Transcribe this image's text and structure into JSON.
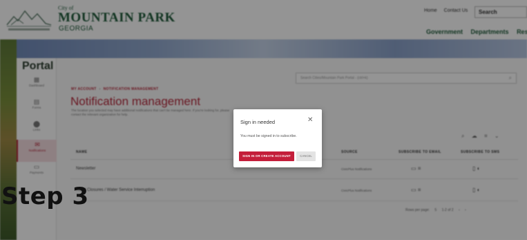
{
  "header": {
    "city_of": "City of",
    "city_name": "MOUNTAIN PARK",
    "state": "GEORGIA",
    "top_links": [
      "Home",
      "Contact Us"
    ],
    "search_placeholder": "Search",
    "nav": [
      "Government",
      "Departments",
      "Reso"
    ]
  },
  "sidebar": {
    "title": "Portal",
    "items": [
      {
        "label": "Dashboard",
        "icon": "dashboard-icon",
        "glyph": "▦"
      },
      {
        "label": "Forms",
        "icon": "forms-icon",
        "glyph": "▤"
      },
      {
        "label": "Links",
        "icon": "links-icon",
        "glyph": "⬤"
      },
      {
        "label": "Notifications",
        "icon": "notifications-icon",
        "glyph": "✉"
      },
      {
        "label": "Payments",
        "icon": "payments-icon",
        "glyph": "▭"
      }
    ]
  },
  "main": {
    "search_placeholder": "Search Cities/Mountain Park Portal - (ctrl+k)",
    "breadcrumb": [
      "MY ACCOUNT",
      "NOTIFICATION MANAGEMENT"
    ],
    "title": "Notification management",
    "description": "The location you selected may have additional notifications that can't be managed here. If you're looking for, please contact the relevant organization for help.",
    "table": {
      "headers": [
        "NAME",
        "SOURCE",
        "SUBSCRIBE TO EMAIL",
        "SUBSCRIBE TO SMS"
      ],
      "rows": [
        {
          "name": "Newsletter",
          "source": "CivicPlus Notifications"
        },
        {
          "name": "Road Closures / Water Service Interruption",
          "source": "CivicPlus Notifications"
        }
      ]
    },
    "pager": {
      "rows_per_page": "Rows per page:",
      "rows_value": "5",
      "range": "1-2 of 2"
    }
  },
  "modal": {
    "title": "Sign in needed",
    "close_glyph": "✕",
    "body": "You must be signed in to subscribe.",
    "primary": "SIGN IN OR CREATE ACCOUNT",
    "secondary": "CANCEL"
  },
  "overlay_label": "Step 3",
  "colors": {
    "brand_green": "#1f5b3a",
    "accent_red": "#c41e3a"
  }
}
